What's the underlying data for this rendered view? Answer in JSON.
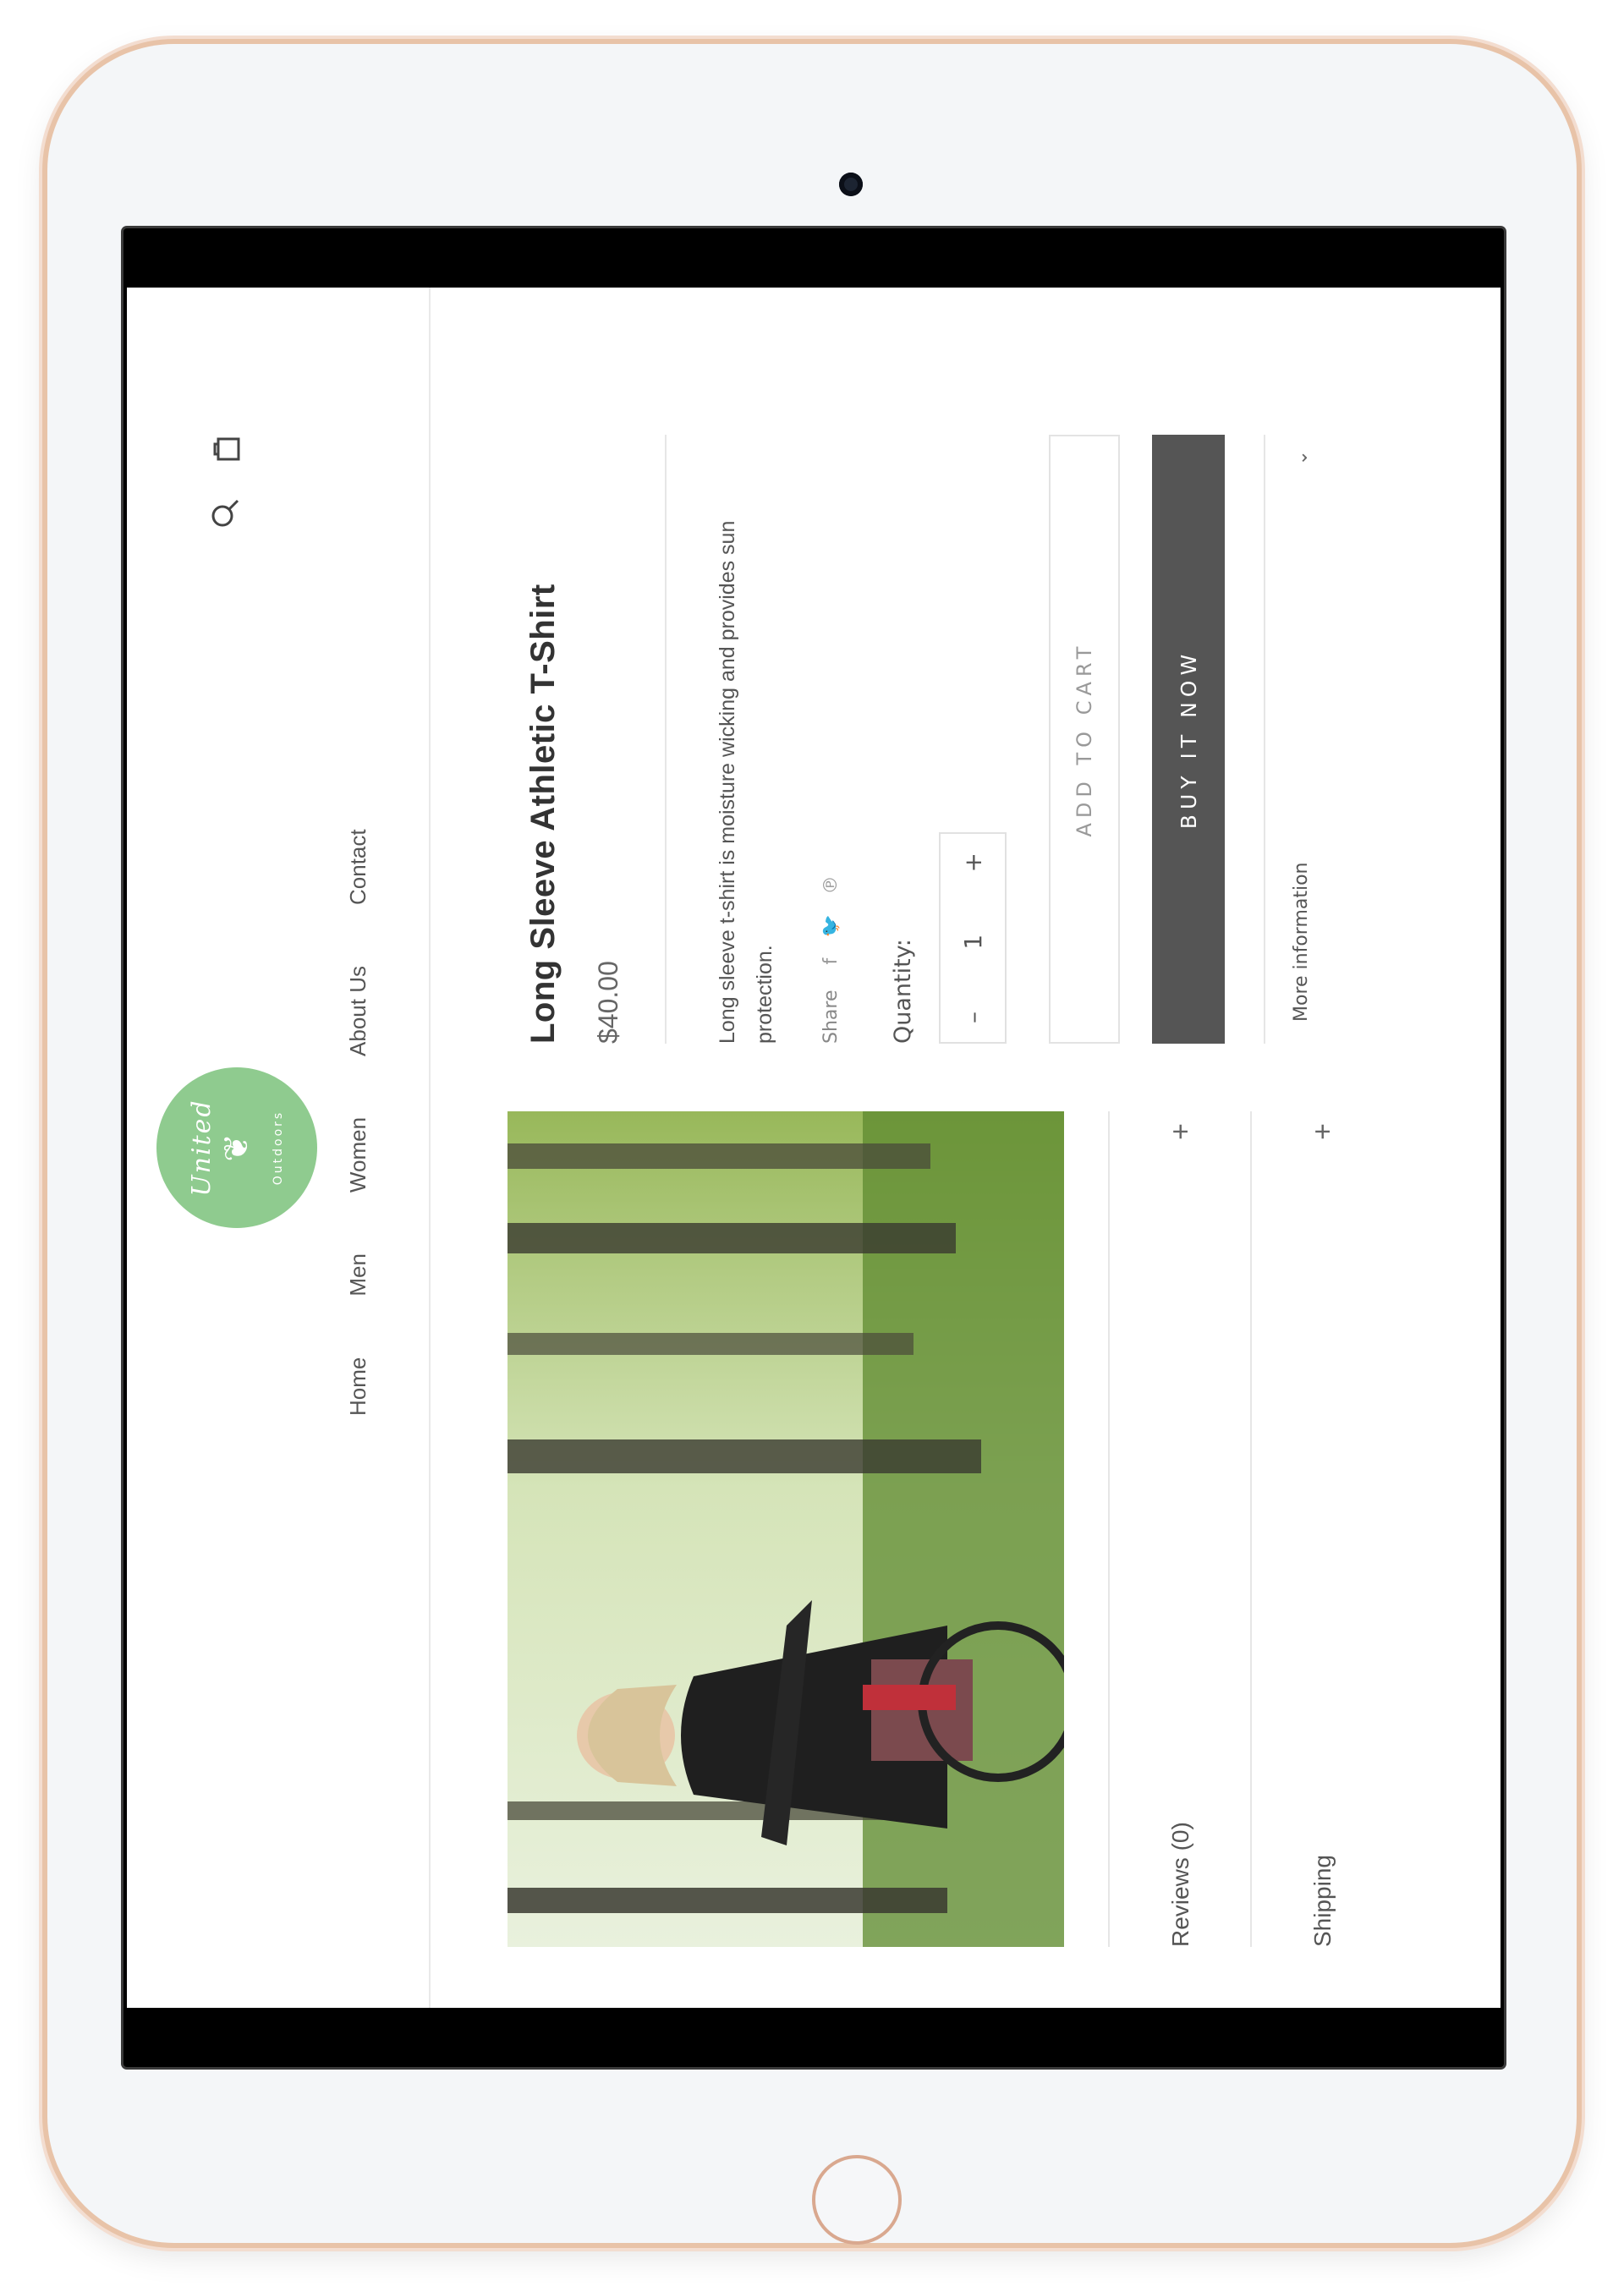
{
  "nav": {
    "items": [
      "Home",
      "Men",
      "Women",
      "About Us",
      "Contact"
    ]
  },
  "brand": {
    "logo_text": "United",
    "logo_sub": "Outdoors",
    "logo_color": "#8fcb8f"
  },
  "header_icons": [
    "search-icon",
    "bag-icon"
  ],
  "product": {
    "title": "Long Sleeve Athletic T-Shirt",
    "price": "$40.00",
    "description": "Long sleeve t-shirt is moisture wicking and provides sun protection.",
    "share_label": "Share",
    "quantity_label": "Quantity:",
    "quantity_value": "1",
    "add_to_cart": "ADD TO CART",
    "buy_now": "BUY IT NOW",
    "more_info": "More information"
  },
  "tabs": {
    "reviews": "Reviews (0)",
    "shipping": "Shipping"
  },
  "colors": {
    "button_dark": "#555555",
    "text": "#333333"
  }
}
